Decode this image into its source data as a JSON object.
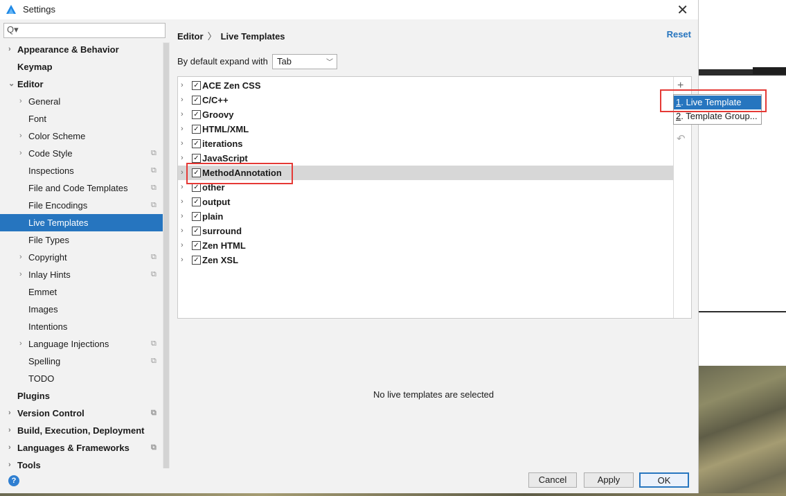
{
  "window": {
    "title": "Settings",
    "close_glyph": "✕"
  },
  "search": {
    "placeholder": "Q▾",
    "icon": "search-icon"
  },
  "sidebar": {
    "items": [
      {
        "label": "Appearance & Behavior",
        "level": 0,
        "bold": true,
        "arrow": "›",
        "project": false,
        "selected": false
      },
      {
        "label": "Keymap",
        "level": 0,
        "bold": true,
        "arrow": "",
        "project": false,
        "selected": false
      },
      {
        "label": "Editor",
        "level": 0,
        "bold": true,
        "arrow": "⌄",
        "project": false,
        "selected": false
      },
      {
        "label": "General",
        "level": 1,
        "bold": false,
        "arrow": "›",
        "project": false,
        "selected": false
      },
      {
        "label": "Font",
        "level": 1,
        "bold": false,
        "arrow": "",
        "project": false,
        "selected": false
      },
      {
        "label": "Color Scheme",
        "level": 1,
        "bold": false,
        "arrow": "›",
        "project": false,
        "selected": false
      },
      {
        "label": "Code Style",
        "level": 1,
        "bold": false,
        "arrow": "›",
        "project": true,
        "selected": false
      },
      {
        "label": "Inspections",
        "level": 1,
        "bold": false,
        "arrow": "",
        "project": true,
        "selected": false
      },
      {
        "label": "File and Code Templates",
        "level": 1,
        "bold": false,
        "arrow": "",
        "project": true,
        "selected": false
      },
      {
        "label": "File Encodings",
        "level": 1,
        "bold": false,
        "arrow": "",
        "project": true,
        "selected": false
      },
      {
        "label": "Live Templates",
        "level": 1,
        "bold": false,
        "arrow": "",
        "project": false,
        "selected": true
      },
      {
        "label": "File Types",
        "level": 1,
        "bold": false,
        "arrow": "",
        "project": false,
        "selected": false
      },
      {
        "label": "Copyright",
        "level": 1,
        "bold": false,
        "arrow": "›",
        "project": true,
        "selected": false
      },
      {
        "label": "Inlay Hints",
        "level": 1,
        "bold": false,
        "arrow": "›",
        "project": true,
        "selected": false
      },
      {
        "label": "Emmet",
        "level": 1,
        "bold": false,
        "arrow": "",
        "project": false,
        "selected": false
      },
      {
        "label": "Images",
        "level": 1,
        "bold": false,
        "arrow": "",
        "project": false,
        "selected": false
      },
      {
        "label": "Intentions",
        "level": 1,
        "bold": false,
        "arrow": "",
        "project": false,
        "selected": false
      },
      {
        "label": "Language Injections",
        "level": 1,
        "bold": false,
        "arrow": "›",
        "project": true,
        "selected": false
      },
      {
        "label": "Spelling",
        "level": 1,
        "bold": false,
        "arrow": "",
        "project": true,
        "selected": false
      },
      {
        "label": "TODO",
        "level": 1,
        "bold": false,
        "arrow": "",
        "project": false,
        "selected": false
      },
      {
        "label": "Plugins",
        "level": 0,
        "bold": true,
        "arrow": "",
        "project": false,
        "selected": false
      },
      {
        "label": "Version Control",
        "level": 0,
        "bold": true,
        "arrow": "›",
        "project": true,
        "selected": false
      },
      {
        "label": "Build, Execution, Deployment",
        "level": 0,
        "bold": true,
        "arrow": "›",
        "project": false,
        "selected": false
      },
      {
        "label": "Languages & Frameworks",
        "level": 0,
        "bold": true,
        "arrow": "›",
        "project": true,
        "selected": false
      },
      {
        "label": "Tools",
        "level": 0,
        "bold": true,
        "arrow": "›",
        "project": false,
        "selected": false
      }
    ]
  },
  "header": {
    "crumb_parent": "Editor",
    "crumb_sep": "〉",
    "crumb_current": "Live Templates",
    "reset_label": "Reset"
  },
  "expand": {
    "label": "By default expand with",
    "value": "Tab"
  },
  "template_groups": [
    {
      "name": "ACE Zen CSS",
      "checked": true,
      "highlighted": false
    },
    {
      "name": "C/C++",
      "checked": true,
      "highlighted": false
    },
    {
      "name": "Groovy",
      "checked": true,
      "highlighted": false
    },
    {
      "name": "HTML/XML",
      "checked": true,
      "highlighted": false
    },
    {
      "name": "iterations",
      "checked": true,
      "highlighted": false
    },
    {
      "name": "JavaScript",
      "checked": true,
      "highlighted": false
    },
    {
      "name": "MethodAnnotation",
      "checked": true,
      "highlighted": true
    },
    {
      "name": "other",
      "checked": true,
      "highlighted": false
    },
    {
      "name": "output",
      "checked": true,
      "highlighted": false
    },
    {
      "name": "plain",
      "checked": true,
      "highlighted": false
    },
    {
      "name": "surround",
      "checked": true,
      "highlighted": false
    },
    {
      "name": "Zen HTML",
      "checked": true,
      "highlighted": false
    },
    {
      "name": "Zen XSL",
      "checked": true,
      "highlighted": false
    }
  ],
  "toolbar": {
    "add_glyph": "+",
    "undo_glyph": "↶"
  },
  "popup": {
    "items": [
      {
        "mnemonic": "1",
        "label": ". Live Template"
      },
      {
        "mnemonic": "2",
        "label": ". Template Group..."
      }
    ]
  },
  "empty_message": "No live templates are selected",
  "buttons": {
    "cancel": "Cancel",
    "apply": "Apply",
    "ok": "OK"
  },
  "help_glyph": "?",
  "colors": {
    "accent": "#2675bf",
    "highlight_box": "#e53935",
    "selected_row": "#2675bf"
  }
}
